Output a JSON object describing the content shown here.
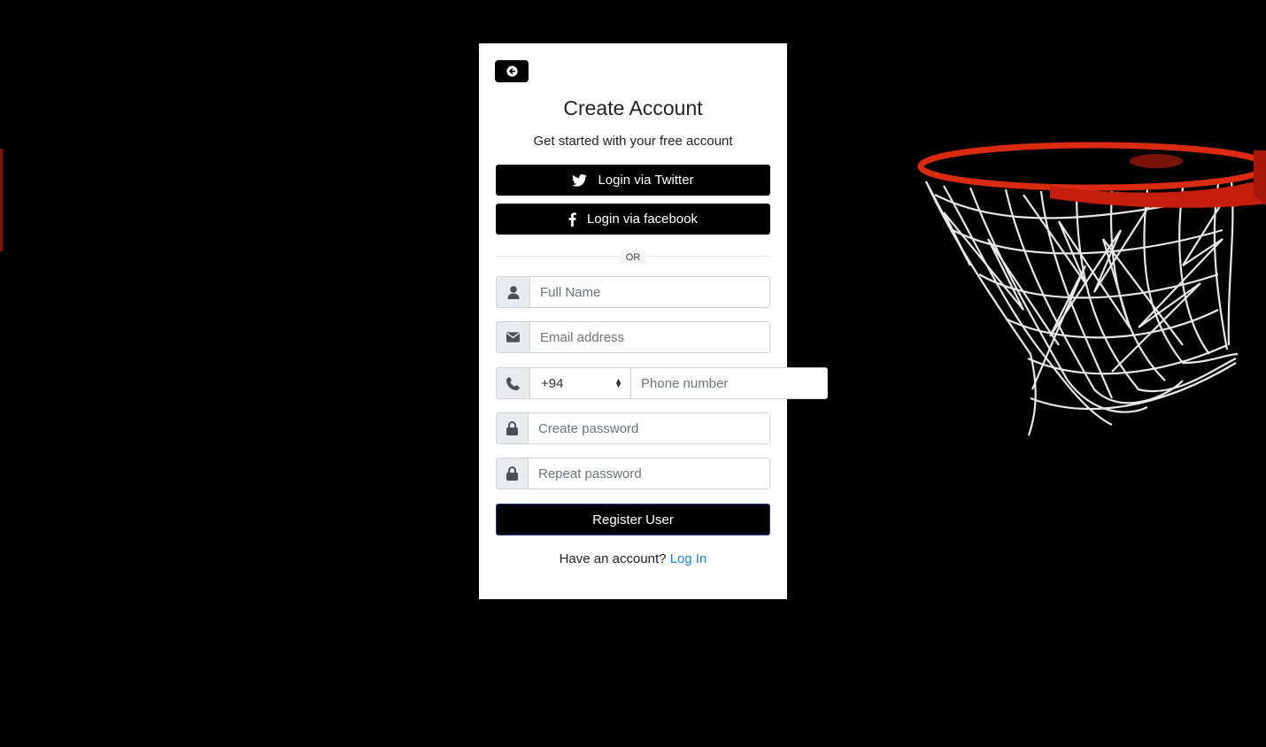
{
  "form": {
    "title": "Create Account",
    "subtitle": "Get started with your free account",
    "twitter_label": "Login via Twitter",
    "facebook_label": "Login via facebook",
    "divider_label": "OR",
    "full_name_placeholder": "Full Name",
    "email_placeholder": "Email address",
    "country_code": "+94",
    "phone_placeholder": "Phone number",
    "create_password_placeholder": "Create password",
    "repeat_password_placeholder": "Repeat password",
    "register_label": "Register User",
    "have_account_text": "Have an account?",
    "login_link": "Log In"
  },
  "icons": {
    "back": "arrow-left-circle-icon",
    "twitter": "twitter-icon",
    "facebook": "facebook-icon",
    "user": "user-icon",
    "email": "envelope-icon",
    "phone": "phone-icon",
    "lock": "lock-icon",
    "select_arrows": "sort-icon"
  },
  "colors": {
    "page_background": "#000000",
    "card_background": "#ffffff",
    "button_background": "#000000",
    "link": "#1a7fe0",
    "addon_background": "#e9ecef"
  }
}
